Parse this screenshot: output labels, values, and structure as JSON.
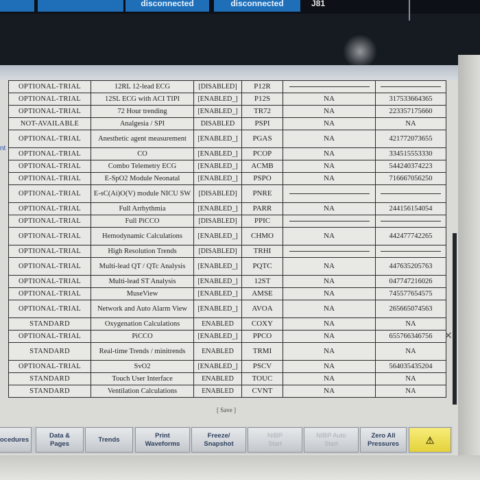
{
  "top_bar": {
    "tab_a": "disconnected",
    "tab_b": "disconnected",
    "bed_label": "J81"
  },
  "edge_text": "nt",
  "table": {
    "rows": [
      {
        "status": "OPTIONAL-TRIAL",
        "function": "12RL 12-lead ECG",
        "enabled": "[DISABLED]",
        "code": "P12R",
        "na": "",
        "number": "",
        "blank": true
      },
      {
        "status": "OPTIONAL-TRIAL",
        "function": "12SL ECG with ACI TIPI",
        "enabled": "[ENABLED_]",
        "code": "P12S",
        "na": "NA",
        "number": "317533664365"
      },
      {
        "status": "OPTIONAL-TRIAL",
        "function": "72 Hour trending",
        "enabled": "[ENABLED_]",
        "code": "TR72",
        "na": "NA",
        "number": "223357175660"
      },
      {
        "status": "NOT-AVAILABLE",
        "function": "Analgesia / SPI",
        "enabled": "DISABLED",
        "code": "PSPI",
        "na": "NA",
        "number": "NA"
      },
      {
        "status": "OPTIONAL-TRIAL",
        "function": "Anesthetic agent measurement",
        "enabled": "[ENABLED_]",
        "code": "PGAS",
        "na": "NA",
        "number": "421772073655",
        "tall": true
      },
      {
        "status": "OPTIONAL-TRIAL",
        "function": "CO",
        "enabled": "[ENABLED_]",
        "code": "PCOP",
        "na": "NA",
        "number": "334515553330"
      },
      {
        "status": "OPTIONAL-TRIAL",
        "function": "Combo Telemetry ECG",
        "enabled": "[ENABLED_]",
        "code": "ACMB",
        "na": "NA",
        "number": "544240374223"
      },
      {
        "status": "OPTIONAL-TRIAL",
        "function": "E-SpO2 Module Neonatal",
        "enabled": "[ENABLED_]",
        "code": "PSPO",
        "na": "NA",
        "number": "716667056250"
      },
      {
        "status": "OPTIONAL-TRIAL",
        "function": "E-sC(Ai)O(V) module NICU SW",
        "enabled": "[DISABLED]",
        "code": "PNRE",
        "na": "",
        "number": "",
        "blank": true,
        "tall": true
      },
      {
        "status": "OPTIONAL-TRIAL",
        "function": "Full Arrhythmia",
        "enabled": "[ENABLED_]",
        "code": "PARR",
        "na": "NA",
        "number": "244156154054"
      },
      {
        "status": "OPTIONAL-TRIAL",
        "function": "Full PiCCO",
        "enabled": "[DISABLED]",
        "code": "PPIC",
        "na": "",
        "number": "",
        "blank": true
      },
      {
        "status": "OPTIONAL-TRIAL",
        "function": "Hemodynamic Calculations",
        "enabled": "[ENABLED_]",
        "code": "CHMO",
        "na": "NA",
        "number": "442477742265",
        "tall": true
      },
      {
        "status": "OPTIONAL-TRIAL",
        "function": "High Resolution Trends",
        "enabled": "[DISABLED]",
        "code": "TRHI",
        "na": "",
        "number": "",
        "blank": true
      },
      {
        "status": "OPTIONAL-TRIAL",
        "function": "Multi-lead QT / QTc Analysis",
        "enabled": "[ENABLED_]",
        "code": "PQTC",
        "na": "NA",
        "number": "447635205763",
        "tall": true
      },
      {
        "status": "OPTIONAL-TRIAL",
        "function": "Multi-lead ST Analysis",
        "enabled": "[ENABLED_]",
        "code": "12ST",
        "na": "NA",
        "number": "047747216026"
      },
      {
        "status": "OPTIONAL-TRIAL",
        "function": "MuseView",
        "enabled": "[ENABLED_]",
        "code": "AMSE",
        "na": "NA",
        "number": "745577654575"
      },
      {
        "status": "OPTIONAL-TRIAL",
        "function": "Network and Auto Alarm View",
        "enabled": "[ENABLED_]",
        "code": "AVOA",
        "na": "NA",
        "number": "265665074563",
        "tall": true
      },
      {
        "status": "STANDARD",
        "function": "Oxygenation Calculations",
        "enabled": "ENABLED",
        "code": "COXY",
        "na": "NA",
        "number": "NA"
      },
      {
        "status": "OPTIONAL-TRIAL",
        "function": "PiCCO",
        "enabled": "[ENABLED_]",
        "code": "PPCO",
        "na": "NA",
        "number": "655766346756"
      },
      {
        "status": "STANDARD",
        "function": "Real-time Trends / minitrends",
        "enabled": "ENABLED",
        "code": "TRMI",
        "na": "NA",
        "number": "NA",
        "tall": true
      },
      {
        "status": "OPTIONAL-TRIAL",
        "function": "SvO2",
        "enabled": "[ENABLED_]",
        "code": "PSCV",
        "na": "NA",
        "number": "564035435204"
      },
      {
        "status": "STANDARD",
        "function": "Touch User Interface",
        "enabled": "ENABLED",
        "code": "TOUC",
        "na": "NA",
        "number": "NA"
      },
      {
        "status": "STANDARD",
        "function": "Ventilation Calculations",
        "enabled": "ENABLED",
        "code": "CVNT",
        "na": "NA",
        "number": "NA"
      }
    ]
  },
  "save_label": "[ Save ]",
  "softkeys": [
    {
      "label": "ocedures",
      "disabled": false
    },
    {
      "label": "Data &\nPages",
      "disabled": false
    },
    {
      "label": "Trends",
      "disabled": false
    },
    {
      "label": "Print\nWaveforms",
      "disabled": false
    },
    {
      "label": "Freeze/\nSnapshot",
      "disabled": false
    },
    {
      "label": "NIBP\nStart",
      "disabled": true
    },
    {
      "label": "NIBP Auto\nStart",
      "disabled": true
    },
    {
      "label": "Zero All\nPressures",
      "disabled": false
    },
    {
      "label": "⚠",
      "disabled": false,
      "alarm": true
    }
  ]
}
